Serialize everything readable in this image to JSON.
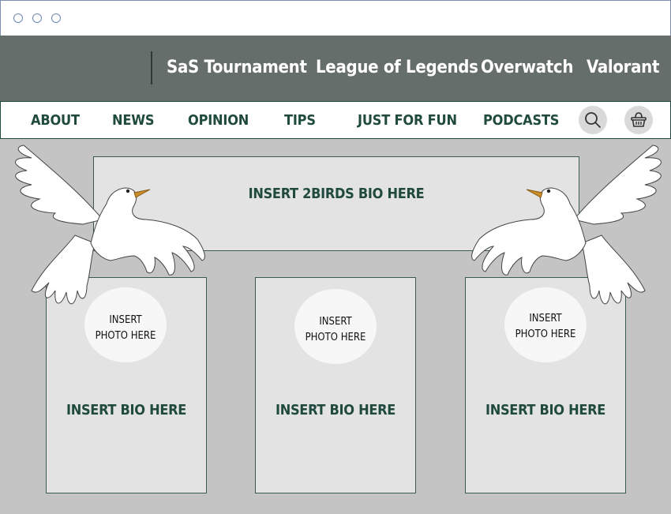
{
  "window": {
    "controls": [
      "circle",
      "circle",
      "circle"
    ]
  },
  "top_nav": {
    "links": [
      "SaS Tournament",
      "League of Legends",
      "Overwatch",
      "Valorant"
    ]
  },
  "sub_nav": {
    "links": [
      "ABOUT",
      "NEWS",
      "OPINION",
      "TIPS",
      "JUST FOR FUN",
      "PODCASTS"
    ],
    "search_icon": "search-icon",
    "basket_icon": "basket-icon"
  },
  "banner": {
    "text": "INSERT 2BIRDS BIO HERE"
  },
  "cards": [
    {
      "photo_text": "INSERT\nPHOTO HERE",
      "bio_text": "INSERT BIO HERE"
    },
    {
      "photo_text": "INSERT\nPHOTO HERE",
      "bio_text": "INSERT BIO HERE"
    },
    {
      "photo_text": "INSERT\nPHOTO HERE",
      "bio_text": "INSERT BIO HERE"
    }
  ],
  "colors": {
    "top_nav_bg": "#666e6b",
    "accent": "#1f4a3d",
    "page_bg": "#c4c4c4",
    "panel_bg": "#e3e3e3"
  },
  "decorations": [
    "dove-left",
    "dove-right"
  ]
}
